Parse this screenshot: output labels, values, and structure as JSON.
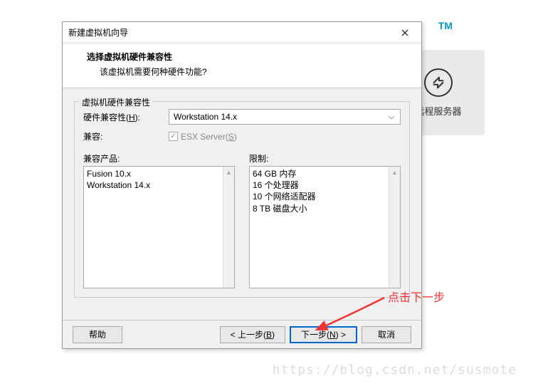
{
  "tm": "TM",
  "bg_panel": {
    "label": "远程服务器"
  },
  "dialog": {
    "title": "新建虚拟机向导",
    "header_title": "选择虚拟机硬件兼容性",
    "header_subtitle": "该虚拟机需要何种硬件功能?",
    "groupbox_label": "虚拟机硬件兼容性",
    "hw_compat_label": "硬件兼容性(",
    "hw_compat_key": "H",
    "hw_compat_suffix": "):",
    "hw_compat_value": "Workstation 14.x",
    "compat_label": "兼容:",
    "esx_label_prefix": "ESX Server(",
    "esx_key": "S",
    "esx_suffix": ")",
    "products_label": "兼容产品:",
    "products": [
      "Fusion 10.x",
      "Workstation 14.x"
    ],
    "limits_label": "限制:",
    "limits": [
      "64 GB 内存",
      "16 个处理器",
      "10 个网络适配器",
      "8 TB 磁盘大小"
    ],
    "buttons": {
      "help": "帮助",
      "back": "< 上一步(",
      "back_key": "B",
      "back_suffix": ")",
      "next": "下一步(",
      "next_key": "N",
      "next_suffix": ") >",
      "cancel": "取消"
    }
  },
  "annotation": "点击下一步",
  "watermark": "https://blog.csdn.net/susmote"
}
